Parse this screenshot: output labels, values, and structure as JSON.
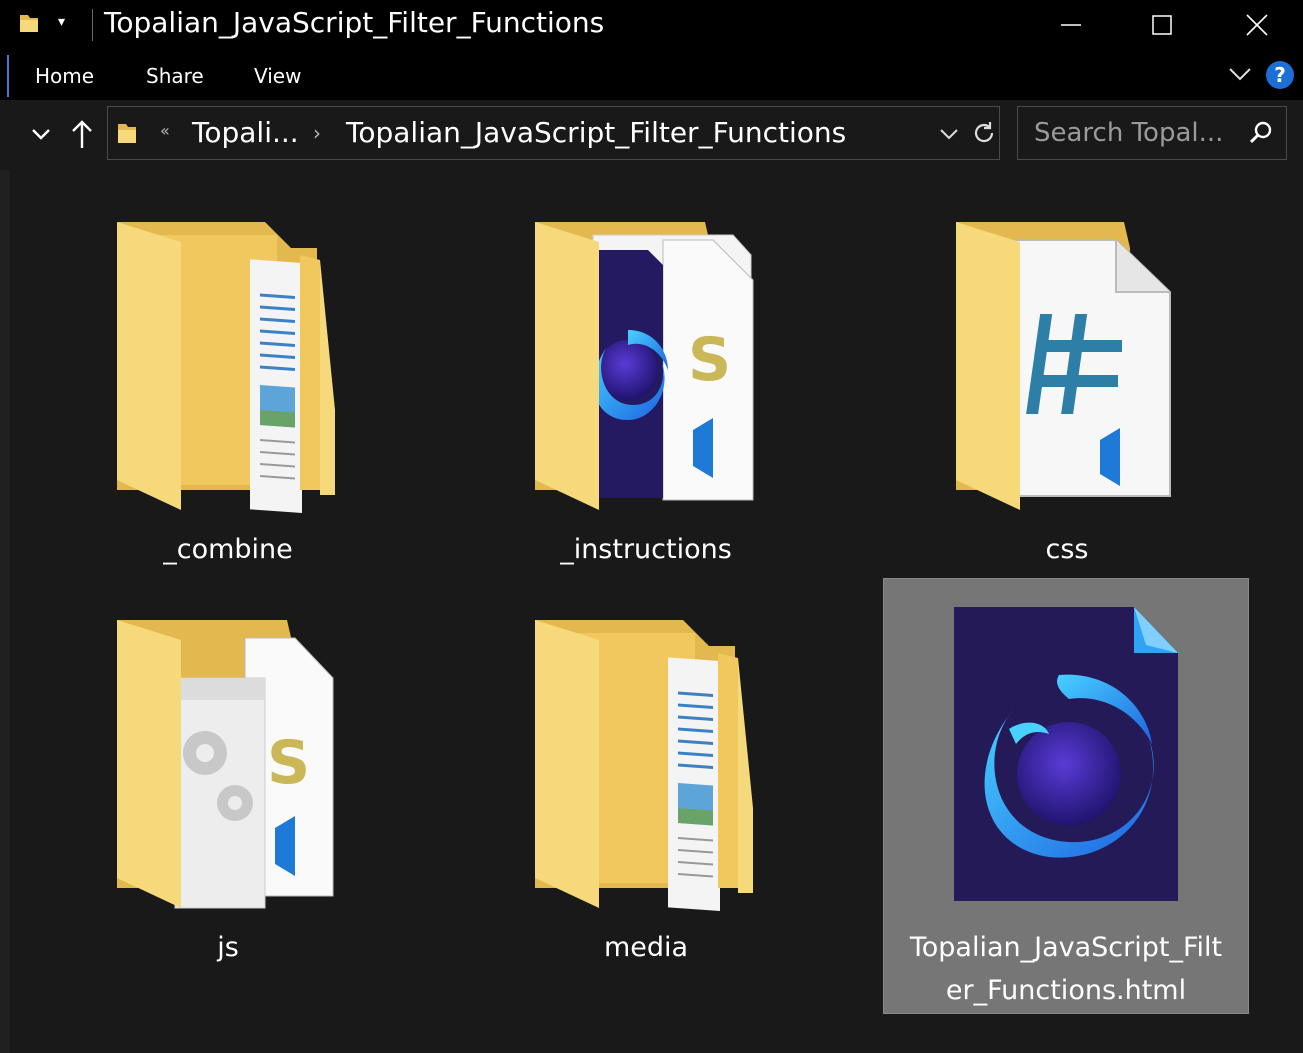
{
  "window": {
    "title": "Topalian_JavaScript_Filter_Functions",
    "quick_access_dropdown": "▾"
  },
  "ribbon": {
    "tabs": [
      {
        "label": "Home"
      },
      {
        "label": "Share"
      },
      {
        "label": "View"
      }
    ],
    "help_label": "?"
  },
  "navigation": {
    "overflow_glyph": "«",
    "breadcrumbs": [
      {
        "label": "Topali..."
      },
      {
        "label": "Topalian_JavaScript_Filter_Functions"
      }
    ],
    "crumb_separator": "›"
  },
  "search": {
    "placeholder": "Search Topal...",
    "value": ""
  },
  "items": [
    {
      "name": "_combine",
      "type": "folder",
      "preview": "document-image"
    },
    {
      "name": "_instructions",
      "type": "folder",
      "preview": "firefox-html-and-js"
    },
    {
      "name": "css",
      "type": "folder",
      "preview": "css-hash-file"
    },
    {
      "name": "js",
      "type": "folder",
      "preview": "gears-and-js"
    },
    {
      "name": "media",
      "type": "folder",
      "preview": "document-image"
    },
    {
      "name_line1": "Topalian_JavaScript_Filt",
      "name_line2": "er_Functions.html",
      "type": "html-file",
      "selected": true,
      "icon": "firefox-developer-icon"
    }
  ],
  "colors": {
    "background": "#191919",
    "titlebar": "#000000",
    "folder_front": "#f6d97a",
    "folder_back": "#e3b94f",
    "selected_bg": "#767676",
    "accent_blue": "#1c6fd6"
  }
}
